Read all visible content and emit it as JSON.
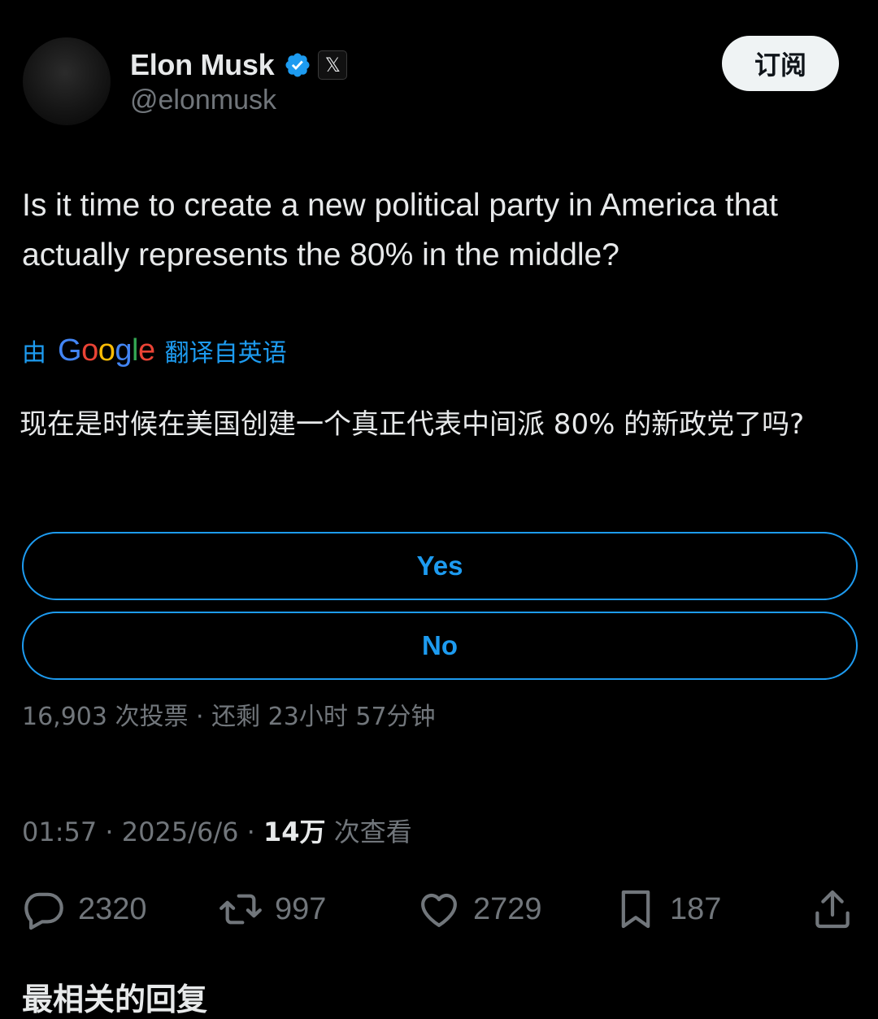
{
  "author": {
    "name": "Elon Musk",
    "handle": "@elonmusk",
    "affiliate_badge": "𝕏"
  },
  "header": {
    "subscribe_label": "订阅"
  },
  "tweet": {
    "text": "Is it time to create a new political party in America that actually represents the 80% in the middle?",
    "translation": {
      "by_label": "由",
      "google": [
        "G",
        "o",
        "o",
        "g",
        "l",
        "e"
      ],
      "from_label": "翻译自英语",
      "text": "现在是时候在美国创建一个真正代表中间派 80% 的新政党了吗?"
    }
  },
  "poll": {
    "options": [
      "Yes",
      "No"
    ],
    "meta": "16,903 次投票 · 还剩 23小时 57分钟"
  },
  "timestamp": {
    "time_date": "01:57 · 2025/6/6 · ",
    "views_count": "14万",
    "views_label": " 次查看"
  },
  "actions": {
    "reply_count": "2320",
    "repost_count": "997",
    "like_count": "2729",
    "bookmark_count": "187"
  },
  "icons": [
    "verified-icon",
    "x-logo-icon",
    "reply-icon",
    "repost-icon",
    "like-icon",
    "bookmark-icon",
    "share-icon"
  ],
  "colors": {
    "accent": "#1d9bf0",
    "muted": "#71767b",
    "text": "#e7e9ea",
    "background": "#000000"
  },
  "cutoff_text": "最相关的回复"
}
